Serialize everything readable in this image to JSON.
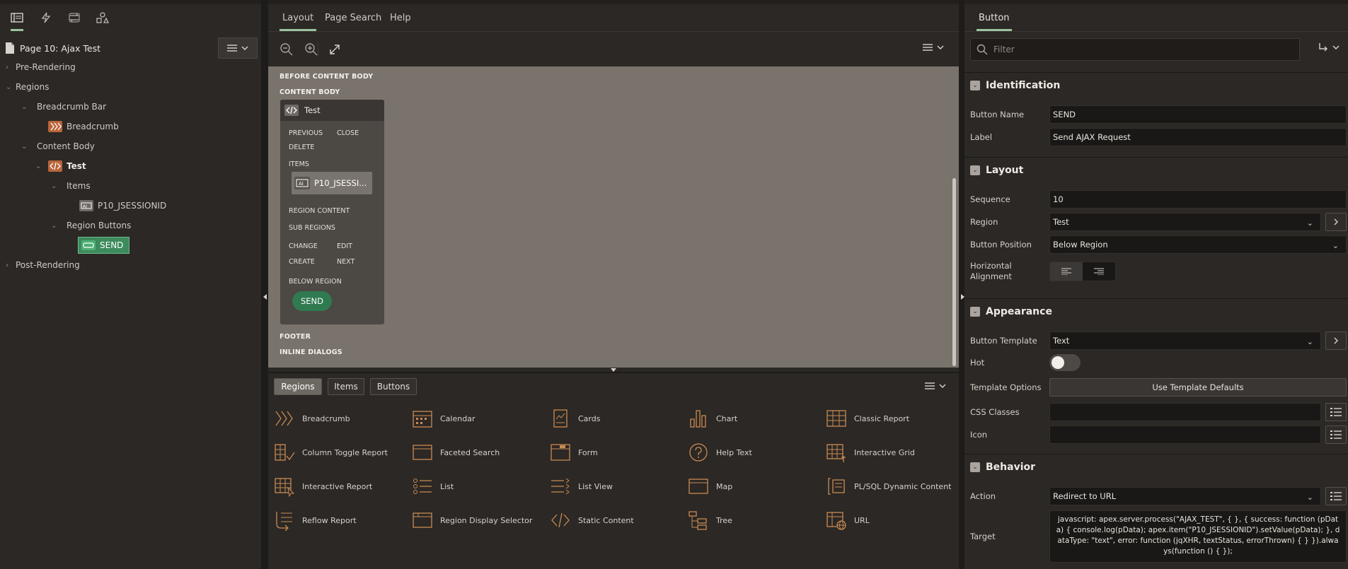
{
  "left": {
    "tabs": [
      "rendering-icon",
      "dynamic-actions-icon",
      "processing-icon",
      "shared-components-icon"
    ],
    "page_title": "Page 10: Ajax Test",
    "tree": {
      "pre_rendering": "Pre-Rendering",
      "regions": "Regions",
      "breadcrumb_bar": "Breadcrumb Bar",
      "breadcrumb": "Breadcrumb",
      "content_body": "Content Body",
      "test": "Test",
      "items": "Items",
      "item_p10": "P10_JSESSIONID",
      "region_buttons": "Region Buttons",
      "send": "SEND",
      "post_rendering": "Post-Rendering"
    }
  },
  "center": {
    "tabs": [
      "Layout",
      "Page Search",
      "Help"
    ],
    "canvas": {
      "before_content_body": "BEFORE CONTENT BODY",
      "content_body": "CONTENT BODY",
      "region_title": "Test",
      "previous": "PREVIOUS",
      "close": "CLOSE",
      "delete": "DELETE",
      "items": "ITEMS",
      "item_label": "P10_JSESSI...",
      "region_content": "REGION CONTENT",
      "sub_regions": "SUB REGIONS",
      "change": "CHANGE",
      "edit": "EDIT",
      "create": "CREATE",
      "next": "NEXT",
      "below_region": "BELOW REGION",
      "send": "SEND",
      "footer": "FOOTER",
      "inline_dialogs": "INLINE DIALOGS"
    },
    "gallery_tabs": [
      "Regions",
      "Items",
      "Buttons"
    ],
    "gallery": [
      "Breadcrumb",
      "Calendar",
      "Cards",
      "Chart",
      "Classic Report",
      "Column Toggle Report",
      "Faceted Search",
      "Form",
      "Help Text",
      "Interactive Grid",
      "Interactive Report",
      "List",
      "List View",
      "Map",
      "PL/SQL Dynamic Content",
      "Reflow Report",
      "Region Display Selector",
      "Static Content",
      "Tree",
      "URL"
    ]
  },
  "right": {
    "title": "Button",
    "filter_placeholder": "Filter",
    "identification": {
      "title": "Identification",
      "button_name_label": "Button Name",
      "button_name": "SEND",
      "label_label": "Label",
      "label": "Send AJAX Request"
    },
    "layout": {
      "title": "Layout",
      "sequence_label": "Sequence",
      "sequence": "10",
      "region_label": "Region",
      "region": "Test",
      "button_position_label": "Button Position",
      "button_position": "Below Region",
      "horizontal_alignment_label": "Horizontal Alignment"
    },
    "appearance": {
      "title": "Appearance",
      "button_template_label": "Button Template",
      "button_template": "Text",
      "hot_label": "Hot",
      "hot": false,
      "template_options_label": "Template Options",
      "template_options_btn": "Use Template Defaults",
      "css_classes_label": "CSS Classes",
      "icon_label": "Icon"
    },
    "behavior": {
      "title": "Behavior",
      "action_label": "Action",
      "action": "Redirect to URL",
      "target_label": "Target",
      "target": "javascript: apex.server.process(\"AJAX_TEST\", { }, { success: function (pData) { console.log(pData); apex.item(\"P10_JSESSIONID\").setValue(pData); }, dataType: \"text\", error: function (jqXHR, textStatus, errorThrown) { } }).always(function () { });"
    }
  },
  "colors": {
    "accent_green": "#9cc3a0",
    "send_green": "#2f7a50",
    "icon_orange": "#c98b52",
    "canvas": "#7a736c"
  }
}
